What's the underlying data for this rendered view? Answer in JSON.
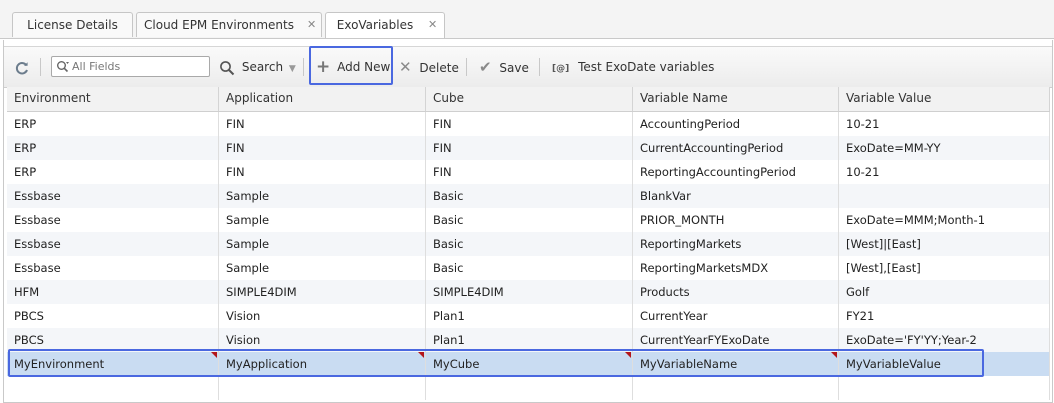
{
  "tabs": [
    {
      "label": "License Details",
      "closable": false,
      "active": false
    },
    {
      "label": "Cloud EPM Environments",
      "closable": true,
      "active": false
    },
    {
      "label": "ExoVariables",
      "closable": true,
      "active": true
    }
  ],
  "toolbar": {
    "search_placeholder": "All Fields",
    "search_label": "Search",
    "add_new_label": "Add New",
    "delete_label": "Delete",
    "save_label": "Save",
    "test_label": "Test ExoDate variables",
    "test_icon_text": "[@]"
  },
  "grid": {
    "columns": [
      "Environment",
      "Application",
      "Cube",
      "Variable Name",
      "Variable Value"
    ],
    "rows": [
      {
        "c": [
          "ERP",
          "FIN",
          "FIN",
          "AccountingPeriod",
          "10-21"
        ]
      },
      {
        "c": [
          "ERP",
          "FIN",
          "FIN",
          "CurrentAccountingPeriod",
          "ExoDate=MM-YY"
        ]
      },
      {
        "c": [
          "ERP",
          "FIN",
          "FIN",
          "ReportingAccountingPeriod",
          "10-21"
        ]
      },
      {
        "c": [
          "Essbase",
          "Sample",
          "Basic",
          "BlankVar",
          ""
        ]
      },
      {
        "c": [
          "Essbase",
          "Sample",
          "Basic",
          "PRIOR_MONTH",
          "ExoDate=MMM;Month-1"
        ]
      },
      {
        "c": [
          "Essbase",
          "Sample",
          "Basic",
          "ReportingMarkets",
          "[West]|[East]"
        ]
      },
      {
        "c": [
          "Essbase",
          "Sample",
          "Basic",
          "ReportingMarketsMDX",
          "[West],[East]"
        ]
      },
      {
        "c": [
          "HFM",
          "SIMPLE4DIM",
          "SIMPLE4DIM",
          "Products",
          "Golf"
        ]
      },
      {
        "c": [
          "PBCS",
          "Vision",
          "Plan1",
          "CurrentYear",
          "FY21"
        ]
      },
      {
        "c": [
          "PBCS",
          "Vision",
          "Plan1",
          "CurrentYearFYExoDate",
          "ExoDate='FY'YY;Year-2"
        ]
      },
      {
        "c": [
          "MyEnvironment",
          "MyApplication",
          "MyCube",
          "MyVariableName",
          "MyVariableValue"
        ],
        "selected": true,
        "dirty": true
      }
    ]
  },
  "colors": {
    "highlight": "#4a68e0",
    "selected_row": "#c9dcf2",
    "dirty_marker": "#b3161b"
  }
}
